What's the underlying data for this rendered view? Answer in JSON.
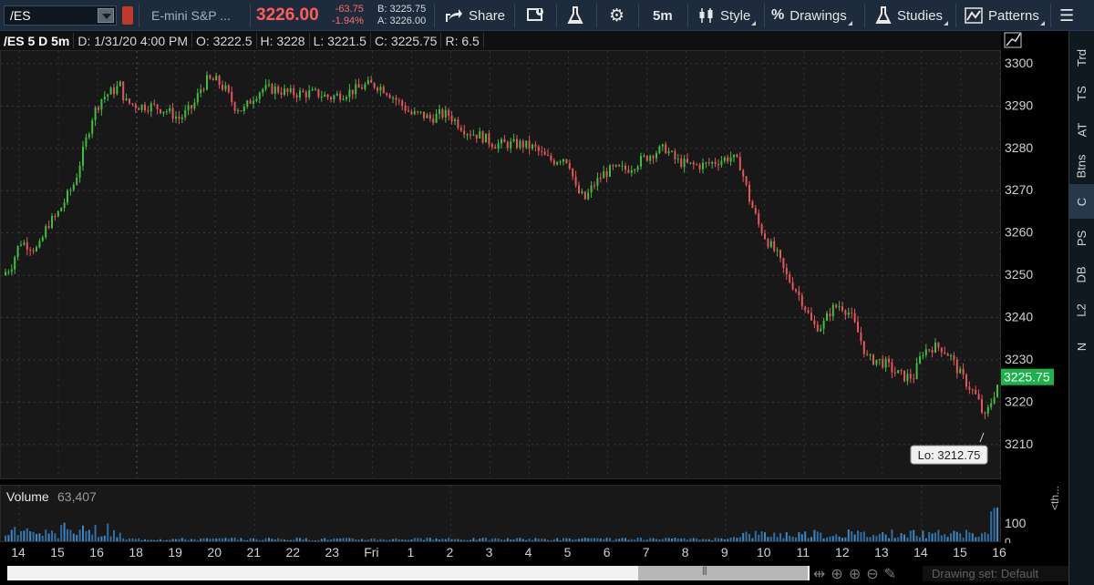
{
  "toolbar": {
    "symbol": "/ES",
    "description": "E-mini S&P ...",
    "last_price": "3226.00",
    "net_change": "-63.75",
    "pct_change": "-1.94%",
    "bid": "B: 3225.75",
    "ask": "A: 3226.00",
    "share_label": "Share",
    "timeframe": "5m",
    "style_label": "Style",
    "drawings_label": "Drawings",
    "studies_label": "Studies",
    "patterns_label": "Patterns"
  },
  "info": {
    "title": "/ES 5 D 5m",
    "date": "D: 1/31/20 4:00 PM",
    "open": "O: 3222.5",
    "high": "H: 3228",
    "low": "L: 3221.5",
    "close": "C: 3225.75",
    "range": "R: 6.5"
  },
  "side_tabs": [
    "Trd",
    "TS",
    "AT",
    "Btns",
    "C",
    "PS",
    "DB",
    "L2",
    "N"
  ],
  "volume": {
    "label": "Volume",
    "value": "63,407",
    "tick_100": "100",
    "tick_0": "0"
  },
  "bottom": {
    "drawing_set": "Drawing set: Default",
    "th_label": "<th..."
  },
  "colors": {
    "up": "#3fbf3f",
    "down": "#e5565c",
    "price_tag": "#1db34c",
    "low_label_bg": "#f0f0f0"
  },
  "chart_data": {
    "type": "candlestick",
    "y_ticks": [
      3210,
      3220,
      3230,
      3240,
      3250,
      3260,
      3270,
      3280,
      3290,
      3300
    ],
    "ylim": [
      3202,
      3303
    ],
    "x_ticks": [
      "14",
      "15",
      "16",
      "18",
      "19",
      "20",
      "21",
      "22",
      "23",
      "Fri",
      "1",
      "2",
      "3",
      "4",
      "5",
      "6",
      "7",
      "8",
      "9",
      "10",
      "11",
      "12",
      "13",
      "14",
      "15",
      "16"
    ],
    "current_price_label": "3225.75",
    "low_label": "Lo: 3212.75",
    "low_value": 3212.75,
    "path": [
      [
        0,
        3250
      ],
      [
        10,
        3252
      ],
      [
        20,
        3258
      ],
      [
        30,
        3257
      ],
      [
        40,
        3256
      ],
      [
        50,
        3262
      ],
      [
        60,
        3264
      ],
      [
        70,
        3268
      ],
      [
        80,
        3272
      ],
      [
        90,
        3280
      ],
      [
        100,
        3288
      ],
      [
        110,
        3292
      ],
      [
        125,
        3294
      ],
      [
        130,
        3295
      ],
      [
        135,
        3291
      ],
      [
        150,
        3290
      ],
      [
        165,
        3290
      ],
      [
        180,
        3289
      ],
      [
        195,
        3287
      ],
      [
        210,
        3290
      ],
      [
        218,
        3294
      ],
      [
        225,
        3296
      ],
      [
        235,
        3296
      ],
      [
        245,
        3294
      ],
      [
        255,
        3290
      ],
      [
        265,
        3289
      ],
      [
        275,
        3292
      ],
      [
        285,
        3294
      ],
      [
        300,
        3294
      ],
      [
        315,
        3293
      ],
      [
        330,
        3293
      ],
      [
        345,
        3293
      ],
      [
        360,
        3292
      ],
      [
        375,
        3293
      ],
      [
        390,
        3294
      ],
      [
        400,
        3295
      ],
      [
        410,
        3295
      ],
      [
        420,
        3294
      ],
      [
        430,
        3292
      ],
      [
        440,
        3290
      ],
      [
        450,
        3288
      ],
      [
        460,
        3288
      ],
      [
        470,
        3287
      ],
      [
        480,
        3288
      ],
      [
        490,
        3288
      ],
      [
        500,
        3286
      ],
      [
        510,
        3284
      ],
      [
        525,
        3283
      ],
      [
        540,
        3281
      ],
      [
        555,
        3281
      ],
      [
        570,
        3281
      ],
      [
        585,
        3280
      ],
      [
        595,
        3278
      ],
      [
        605,
        3277
      ],
      [
        615,
        3278
      ],
      [
        622,
        3277
      ],
      [
        630,
        3270
      ],
      [
        640,
        3268
      ],
      [
        648,
        3271
      ],
      [
        660,
        3274
      ],
      [
        670,
        3275
      ],
      [
        685,
        3275
      ],
      [
        700,
        3277
      ],
      [
        715,
        3279
      ],
      [
        728,
        3280
      ],
      [
        740,
        3277
      ],
      [
        755,
        3276
      ],
      [
        770,
        3276
      ],
      [
        785,
        3277
      ],
      [
        800,
        3278
      ],
      [
        810,
        3276
      ],
      [
        820,
        3268
      ],
      [
        830,
        3262
      ],
      [
        840,
        3258
      ],
      [
        850,
        3255
      ],
      [
        860,
        3250
      ],
      [
        870,
        3247
      ],
      [
        880,
        3243
      ],
      [
        890,
        3238
      ],
      [
        900,
        3238
      ],
      [
        910,
        3242
      ],
      [
        920,
        3243
      ],
      [
        930,
        3241
      ],
      [
        940,
        3236
      ],
      [
        950,
        3230
      ],
      [
        960,
        3230
      ],
      [
        970,
        3229
      ],
      [
        980,
        3227
      ],
      [
        990,
        3226
      ],
      [
        1000,
        3226
      ],
      [
        1010,
        3232
      ],
      [
        1020,
        3233
      ],
      [
        1030,
        3233
      ],
      [
        1040,
        3231
      ],
      [
        1050,
        3227
      ],
      [
        1060,
        3224
      ],
      [
        1070,
        3221
      ],
      [
        1078,
        3216
      ],
      [
        1085,
        3220
      ],
      [
        1095,
        3226
      ]
    ]
  }
}
